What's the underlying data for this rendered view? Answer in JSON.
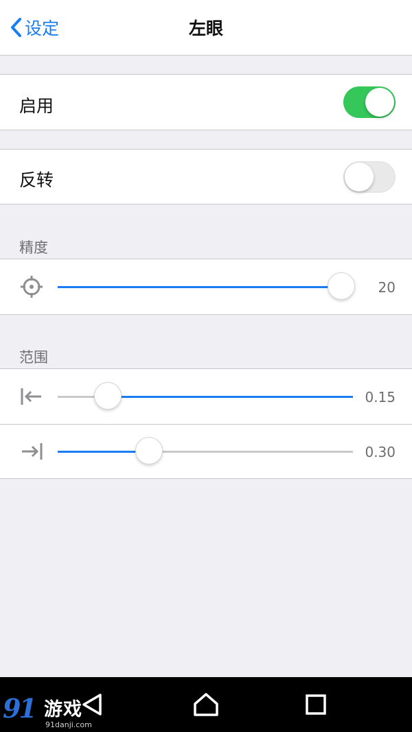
{
  "nav": {
    "back_label": "设定",
    "title": "左眼"
  },
  "settings": {
    "enable": {
      "label": "启用",
      "on": true
    },
    "invert": {
      "label": "反转",
      "on": false
    }
  },
  "precision": {
    "header": "精度",
    "slider": {
      "value_text": "20",
      "fraction": 0.96,
      "icon": "crosshair-icon"
    }
  },
  "range": {
    "header": "范围",
    "min": {
      "value_text": "0.15",
      "fraction": 0.17,
      "fill_side": "right",
      "icon": "arrow-left-to-bar-icon"
    },
    "max": {
      "value_text": "0.30",
      "fraction": 0.31,
      "fill_side": "left",
      "icon": "arrow-right-to-bar-icon"
    }
  },
  "system_bar": {
    "buttons": [
      "back-icon",
      "home-icon",
      "recent-apps-icon"
    ]
  },
  "watermark": {
    "number": "91",
    "brand": "游戏",
    "url": "91danji.com"
  },
  "colors": {
    "accent": "#1a7cf0",
    "toggle_on": "#35c759",
    "background": "#efeff4"
  }
}
